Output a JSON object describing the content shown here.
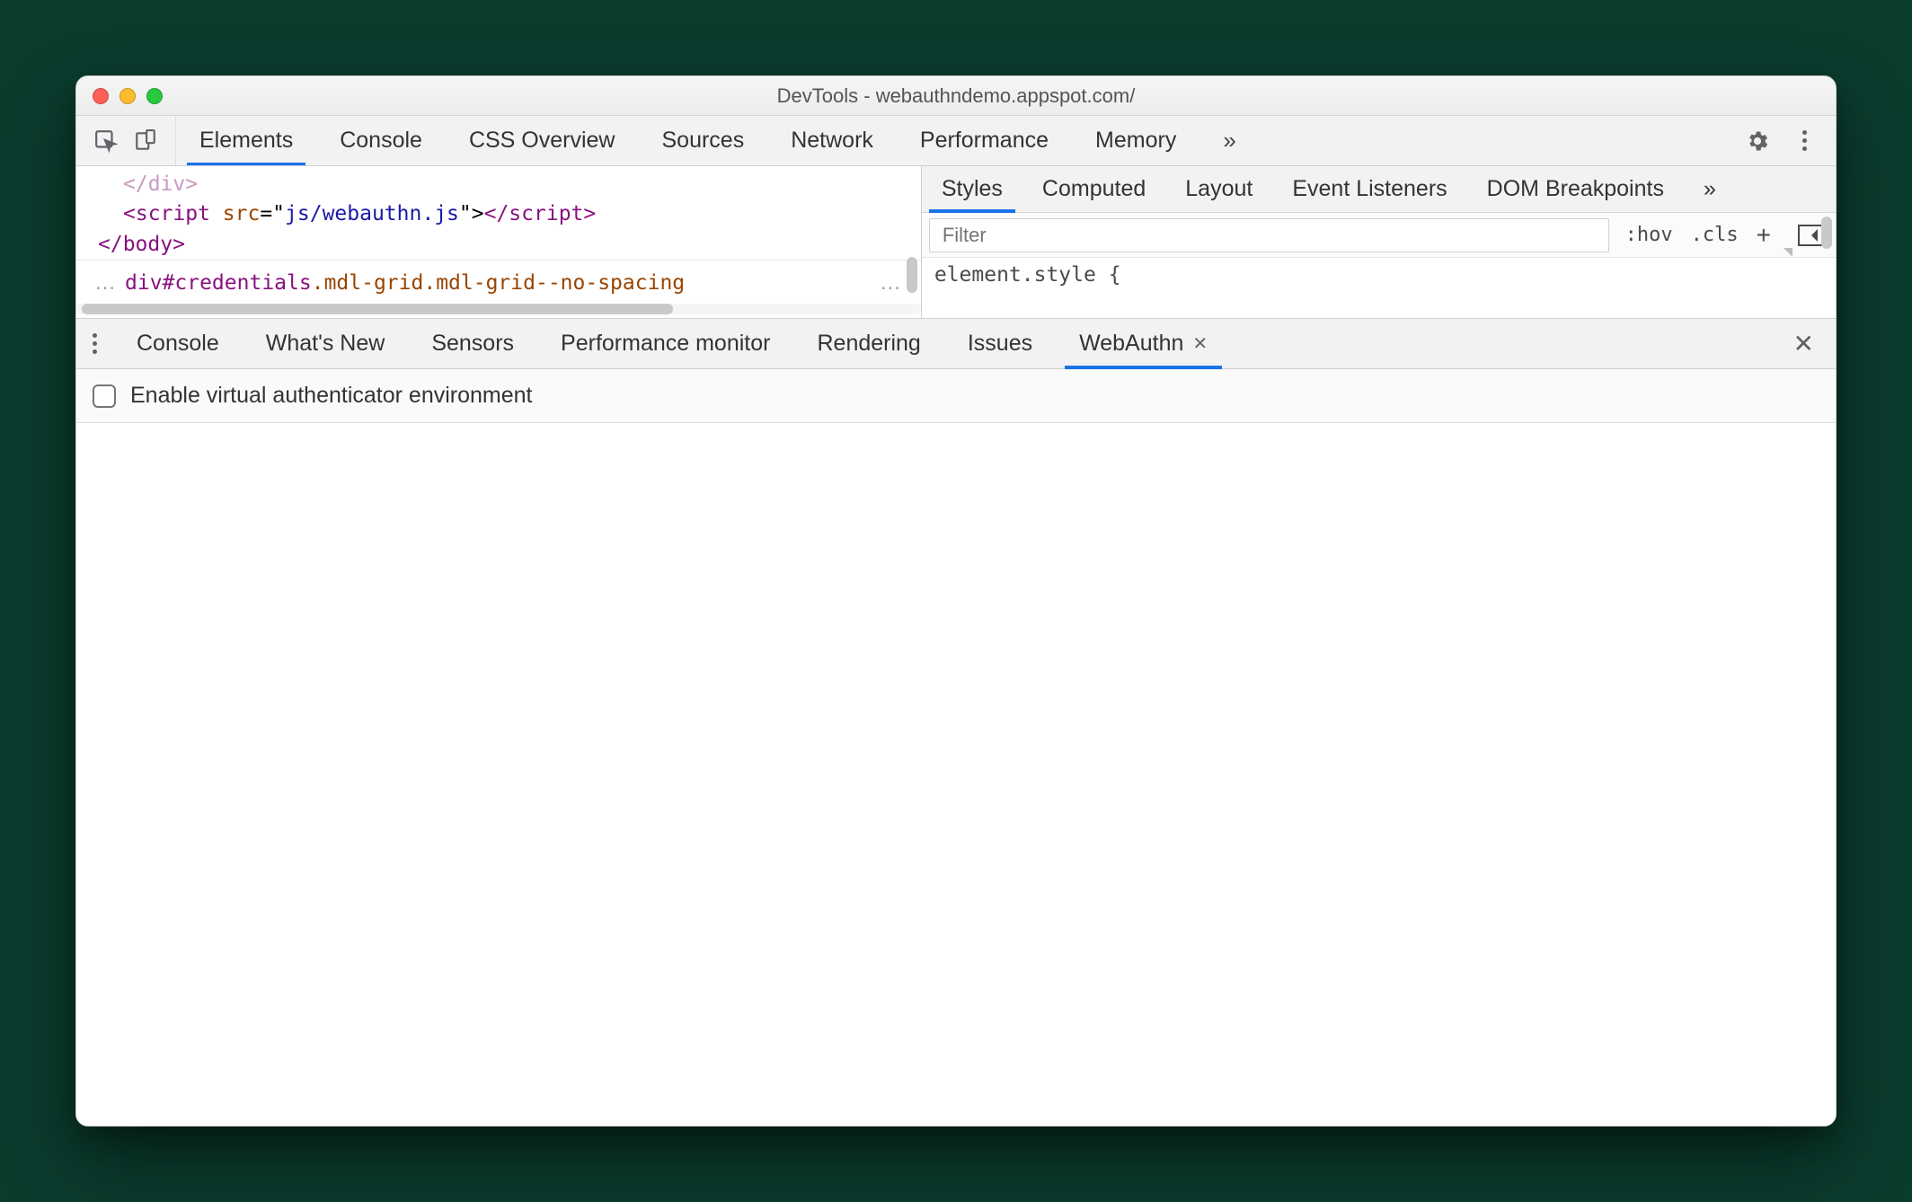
{
  "window": {
    "title": "DevTools - webauthndemo.appspot.com/"
  },
  "mainTabs": {
    "items": [
      "Elements",
      "Console",
      "CSS Overview",
      "Sources",
      "Network",
      "Performance",
      "Memory"
    ],
    "activeIndex": 0,
    "overflow": "»"
  },
  "elementsPane": {
    "code": {
      "line1_closeDiv": "</div>",
      "line2_open": "<script ",
      "line2_attr": "src",
      "line2_eq": "=\"",
      "line2_val": "js/webauthn.js",
      "line2_closeq": "\">",
      "line2_closeTag": "</script>",
      "line3_closeBody": "</body>"
    },
    "breadcrumb": {
      "ellipsis": "…",
      "tag": "div",
      "id": "#credentials",
      "classes": ".mdl-grid.mdl-grid--no-spacing",
      "ellipsis2": "…"
    }
  },
  "stylesPane": {
    "tabs": [
      "Styles",
      "Computed",
      "Layout",
      "Event Listeners",
      "DOM Breakpoints"
    ],
    "activeIndex": 0,
    "overflow": "»",
    "filterPlaceholder": "Filter",
    "hov": ":hov",
    "cls": ".cls",
    "body_line1": "element.style {"
  },
  "drawer": {
    "tabs": [
      "Console",
      "What's New",
      "Sensors",
      "Performance monitor",
      "Rendering",
      "Issues",
      "WebAuthn"
    ],
    "activeIndex": 6,
    "checkboxLabel": "Enable virtual authenticator environment"
  }
}
